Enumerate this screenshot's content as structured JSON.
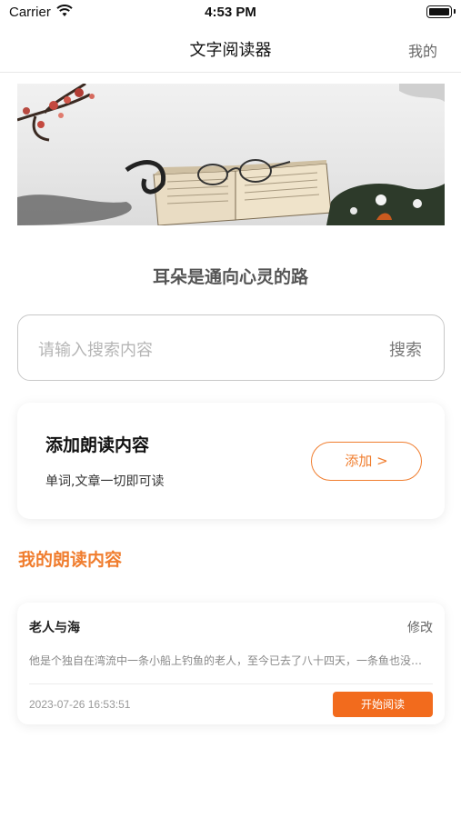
{
  "status_bar": {
    "carrier": "Carrier",
    "time": "4:53 PM"
  },
  "nav": {
    "title": "文字阅读器",
    "mine": "我的"
  },
  "banner": {
    "icon": "ink-painting-book-glasses-image"
  },
  "slogan": "耳朵是通向心灵的路",
  "search": {
    "placeholder": "请输入搜索内容",
    "button": "搜索"
  },
  "add_card": {
    "title": "添加朗读内容",
    "subtitle": "单词,文章一切即可读",
    "button": "添加 >"
  },
  "section": {
    "title": "我的朗读内容"
  },
  "items": [
    {
      "title": "老人与海",
      "edit": "修改",
      "excerpt": "他是个独自在湾流中一条小船上钓鱼的老人，至今已去了八十四天，一条鱼也没逮住。",
      "date": "2023-07-26 16:53:51",
      "start": "开始阅读"
    }
  ],
  "colors": {
    "accent": "#f07d2e",
    "button_fill": "#f26b1d"
  }
}
